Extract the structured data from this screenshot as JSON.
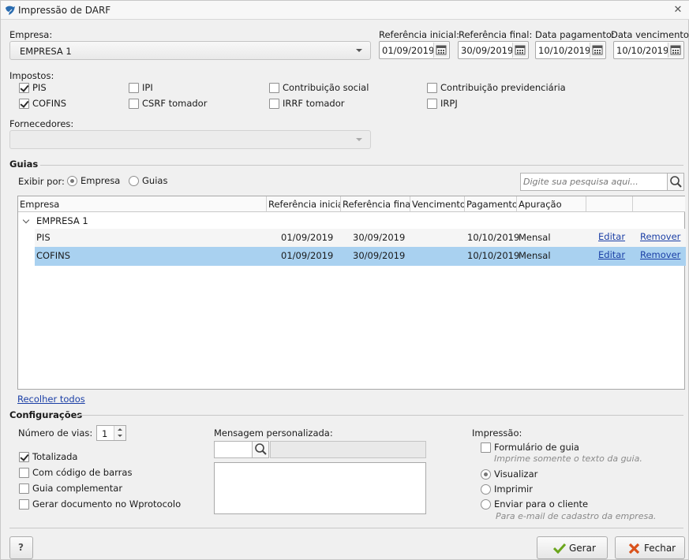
{
  "window": {
    "title": "Impressão de DARF"
  },
  "empresa": {
    "label": "Empresa:",
    "value": "EMPRESA 1"
  },
  "dates": [
    {
      "label": "Referência inicial:",
      "value": "01/09/2019"
    },
    {
      "label": "Referência final:",
      "value": "30/09/2019"
    },
    {
      "label": "Data pagamento:",
      "value": "10/10/2019"
    },
    {
      "label": "Data vencimento:",
      "value": "10/10/2019"
    }
  ],
  "impostos": {
    "label": "Impostos:",
    "items": [
      {
        "label": "PIS",
        "checked": true
      },
      {
        "label": "COFINS",
        "checked": true
      },
      {
        "label": "IPI",
        "checked": false
      },
      {
        "label": "CSRF tomador",
        "checked": false
      },
      {
        "label": "Contribuição social",
        "checked": false
      },
      {
        "label": "IRRF tomador",
        "checked": false
      },
      {
        "label": "Contribuição previdenciária",
        "checked": false
      },
      {
        "label": "IRPJ",
        "checked": false
      }
    ]
  },
  "fornecedores": {
    "label": "Fornecedores:",
    "value": ""
  },
  "guias": {
    "title": "Guias",
    "exibir_label": "Exibir por:",
    "options": [
      {
        "label": "Empresa",
        "selected": true
      },
      {
        "label": "Guias",
        "selected": false
      }
    ],
    "search_placeholder": "Digite sua pesquisa aqui...",
    "columns": [
      "Empresa",
      "Referência inicial",
      "Referência final",
      "Vencimento",
      "Pagamento",
      "Apuração",
      "",
      ""
    ],
    "group": "EMPRESA 1",
    "rows": [
      {
        "name": "PIS",
        "ref_ini": "01/09/2019",
        "ref_fim": "30/09/2019",
        "vencimento": "",
        "pagamento": "10/10/2019",
        "apuracao": "Mensal",
        "edit": "Editar",
        "remove": "Remover",
        "selected": false
      },
      {
        "name": "COFINS",
        "ref_ini": "01/09/2019",
        "ref_fim": "30/09/2019",
        "vencimento": "",
        "pagamento": "10/10/2019",
        "apuracao": "Mensal",
        "edit": "Editar",
        "remove": "Remover",
        "selected": true
      }
    ],
    "collapse_link": "Recolher todos"
  },
  "config": {
    "title": "Configurações",
    "vias_label": "Número de vias:",
    "vias_value": "1",
    "checks": [
      {
        "label": "Totalizada",
        "checked": true
      },
      {
        "label": "Com código de barras",
        "checked": false
      },
      {
        "label": "Guia complementar",
        "checked": false
      },
      {
        "label": "Gerar documento no Wprotocolo",
        "checked": false
      }
    ],
    "msg_label": "Mensagem personalizada:",
    "impressao_label": "Impressão:",
    "formulario": {
      "label": "Formulário de guia",
      "hint": "Imprime somente o texto da guia.",
      "checked": false
    },
    "modes": [
      {
        "label": "Visualizar",
        "selected": true
      },
      {
        "label": "Imprimir",
        "selected": false
      },
      {
        "label": "Enviar para o cliente",
        "selected": false
      }
    ],
    "enviar_hint": "Para e-mail de cadastro da empresa."
  },
  "footer": {
    "help": "?",
    "gerar": "Gerar",
    "fechar": "Fechar"
  },
  "colors": {
    "selected_row": "#a9d1f0",
    "link": "#1b3fa6"
  }
}
